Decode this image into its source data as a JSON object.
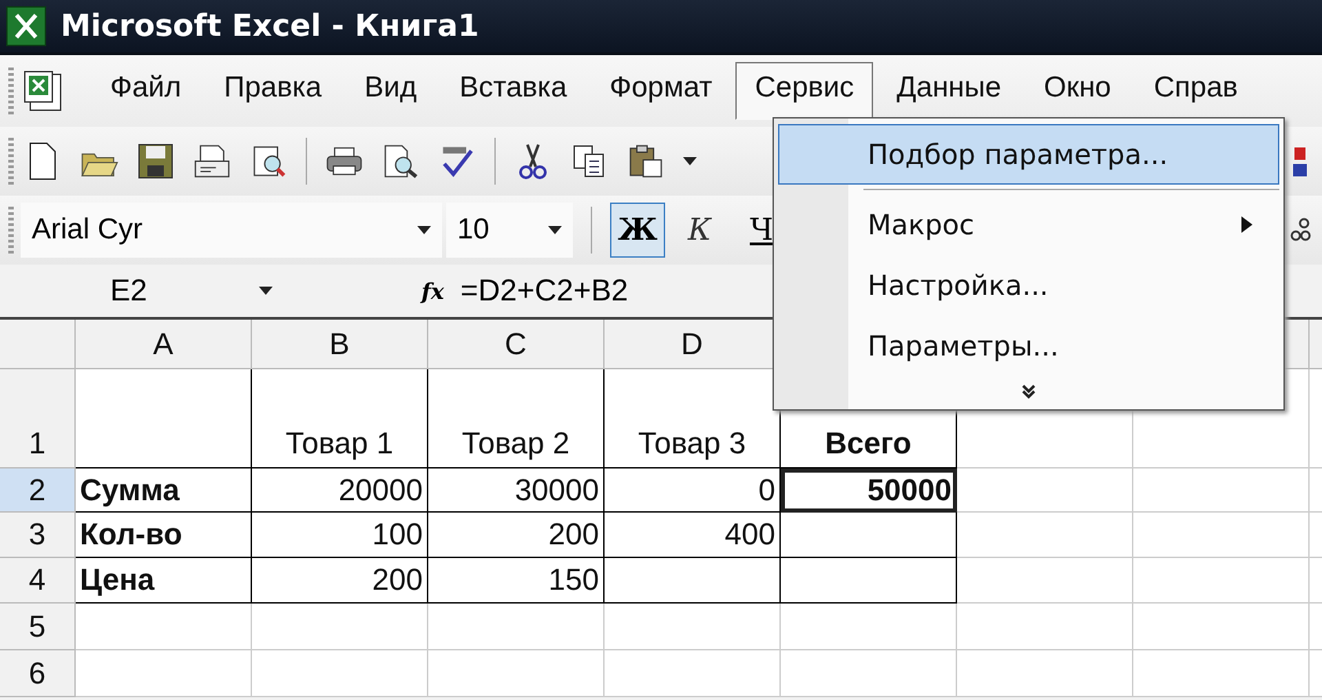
{
  "window": {
    "title": "Microsoft Excel - Книга1"
  },
  "menu": [
    {
      "label": "Файл",
      "selected": false
    },
    {
      "label": "Правка",
      "selected": false
    },
    {
      "label": "Вид",
      "selected": false
    },
    {
      "label": "Вставка",
      "selected": false
    },
    {
      "label": "Формат",
      "selected": false
    },
    {
      "label": "Сервис",
      "selected": true
    },
    {
      "label": "Данные",
      "selected": false
    },
    {
      "label": "Окно",
      "selected": false
    },
    {
      "label": "Справ",
      "selected": false
    }
  ],
  "dropdown": [
    {
      "label": "Подбор параметра...",
      "selected": true,
      "kind": "item"
    },
    {
      "label": "Макрос",
      "selected": false,
      "kind": "submenu"
    },
    {
      "label": "Настройка...",
      "selected": false,
      "kind": "item"
    },
    {
      "label": "Параметры...",
      "selected": false,
      "kind": "item"
    },
    {
      "kind": "more",
      "selected": false
    }
  ],
  "formatting": {
    "font": "Arial Cyr",
    "size": "10",
    "bold_label": "Ж",
    "bold_on": true,
    "italic_label": "К",
    "underline_label": "Ч"
  },
  "formula_bar": {
    "name_box": "E2",
    "fx": "fx",
    "formula": "=D2+C2+B2"
  },
  "sheet": {
    "columns": [
      "A",
      "B",
      "C",
      "D"
    ],
    "rows": [
      {
        "header": "1",
        "selected": false,
        "cells": [
          {
            "selected": false
          },
          {
            "text": "Товар 1",
            "selected": false
          },
          {
            "text": "Товар 2",
            "selected": false
          },
          {
            "text": "Товар 3",
            "selected": false
          },
          {
            "text": "Всего",
            "selected": false
          }
        ]
      },
      {
        "header": "2",
        "selected": true,
        "cells": [
          {
            "text": "Сумма",
            "selected": false
          },
          {
            "text": "20000",
            "selected": false
          },
          {
            "text": "30000",
            "selected": false
          },
          {
            "text": "0",
            "selected": false
          },
          {
            "text": "50000",
            "selected": true
          }
        ]
      },
      {
        "header": "3",
        "selected": false,
        "cells": [
          {
            "text": "Кол-во",
            "selected": false
          },
          {
            "text": "100",
            "selected": false
          },
          {
            "text": "200",
            "selected": false
          },
          {
            "text": "400",
            "selected": false
          },
          {
            "selected": false
          }
        ]
      },
      {
        "header": "4",
        "selected": false,
        "cells": [
          {
            "text": "Цена",
            "selected": false
          },
          {
            "text": "200",
            "selected": false
          },
          {
            "text": "150",
            "selected": false
          },
          {
            "selected": false
          },
          {
            "selected": false
          }
        ]
      },
      {
        "header": "5",
        "selected": false,
        "cells": []
      },
      {
        "header": "6",
        "selected": false,
        "cells": []
      }
    ]
  }
}
